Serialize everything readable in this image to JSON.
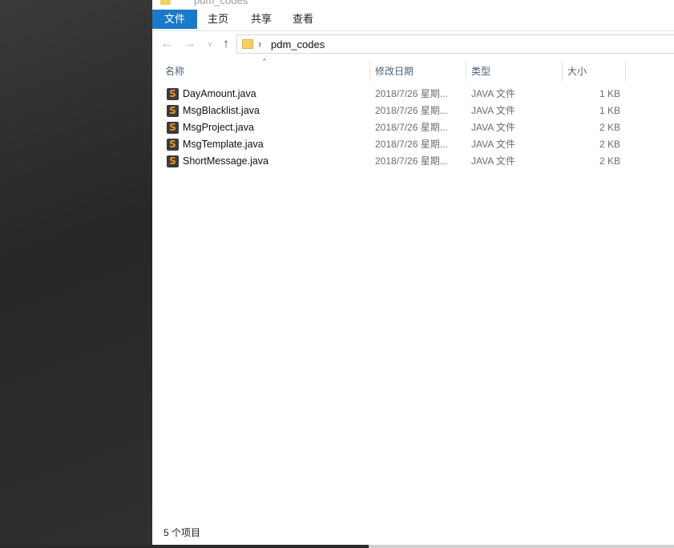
{
  "window": {
    "title_fragment": "pdm_codes"
  },
  "ribbon": {
    "tabs": [
      "文件",
      "主页",
      "共享",
      "查看"
    ]
  },
  "nav": {
    "back_icon": "arrow-left-icon",
    "forward_icon": "arrow-right-icon",
    "recent_icon": "chevron-down-icon",
    "up_icon": "arrow-up-icon"
  },
  "address": {
    "separator": "›",
    "path": "pdm_codes"
  },
  "columns": {
    "name": "名称",
    "date": "修改日期",
    "type": "类型",
    "size": "大小"
  },
  "files": [
    {
      "name": "DayAmount.java",
      "date": "2018/7/26 星期...",
      "type": "JAVA 文件",
      "size": "1 KB"
    },
    {
      "name": "MsgBlacklist.java",
      "date": "2018/7/26 星期...",
      "type": "JAVA 文件",
      "size": "1 KB"
    },
    {
      "name": "MsgProject.java",
      "date": "2018/7/26 星期...",
      "type": "JAVA 文件",
      "size": "2 KB"
    },
    {
      "name": "MsgTemplate.java",
      "date": "2018/7/26 星期...",
      "type": "JAVA 文件",
      "size": "2 KB"
    },
    {
      "name": "ShortMessage.java",
      "date": "2018/7/26 星期...",
      "type": "JAVA 文件",
      "size": "2 KB"
    }
  ],
  "status": {
    "item_count": "5 个项目"
  },
  "colors": {
    "accent": "#1979ca",
    "folder": "#f5cf5f",
    "header_text": "#4c607a",
    "file_icon_bg": "#3b3b3b",
    "file_icon_fg": "#f7931e"
  }
}
